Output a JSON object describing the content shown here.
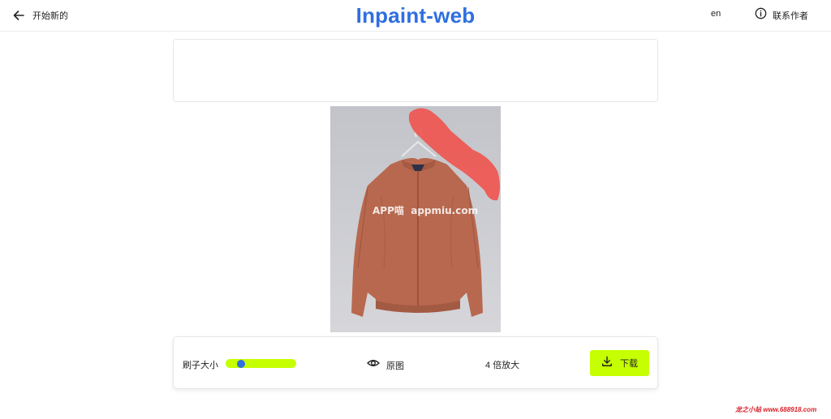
{
  "header": {
    "back_label": "开始新的",
    "title": "Inpaint-web",
    "lang_label": "en",
    "contact_label": "联系作者"
  },
  "canvas": {
    "watermark_text": "APP喵  appmiu.com"
  },
  "toolbar": {
    "brush_label": "刷子大小",
    "brush_level": 0.18,
    "original_label": "原图",
    "upscale_label": "4 倍放大",
    "download_label": "下载"
  },
  "footer_watermark": "龙之小站 www.688918.com",
  "colors": {
    "accent": "#c5ff00",
    "brand": "#2f6fe0",
    "mask": "#f0504a",
    "jacket": "#b66a50"
  }
}
